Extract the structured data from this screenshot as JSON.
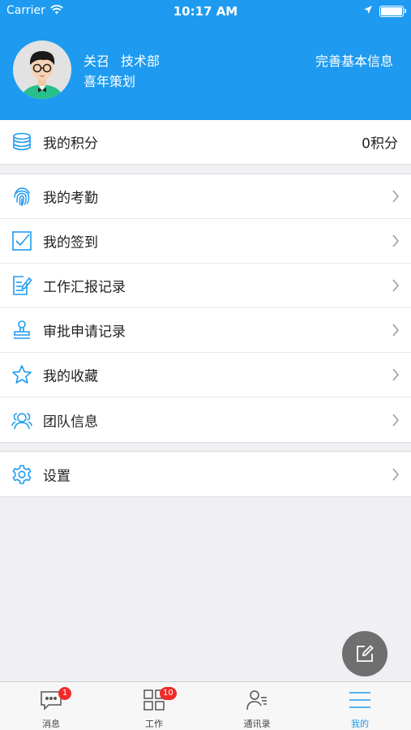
{
  "status_bar": {
    "carrier": "Carrier",
    "time": "10:17 AM"
  },
  "profile": {
    "name": "关召",
    "department": "技术部",
    "organization": "喜年策划",
    "complete_info_link": "完善基本信息"
  },
  "points": {
    "label": "我的积分",
    "value": "0积分"
  },
  "menu": [
    {
      "label": "我的考勤",
      "icon": "fingerprint-icon"
    },
    {
      "label": "我的签到",
      "icon": "checkbox-icon"
    },
    {
      "label": "工作汇报记录",
      "icon": "report-icon"
    },
    {
      "label": "审批申请记录",
      "icon": "stamp-icon"
    },
    {
      "label": "我的收藏",
      "icon": "star-icon"
    },
    {
      "label": "团队信息",
      "icon": "team-icon"
    }
  ],
  "settings": {
    "label": "设置",
    "icon": "gear-icon"
  },
  "tabs": [
    {
      "label": "消息",
      "badge": "1",
      "icon": "message-icon"
    },
    {
      "label": "工作",
      "badge": "10",
      "icon": "grid-icon"
    },
    {
      "label": "通讯录",
      "badge": "",
      "icon": "contacts-icon"
    },
    {
      "label": "我的",
      "badge": "",
      "icon": "menu-icon",
      "active": true
    }
  ],
  "colors": {
    "accent": "#1e9bf0",
    "badge": "#f22a2a",
    "fab": "#6f6f6f"
  }
}
